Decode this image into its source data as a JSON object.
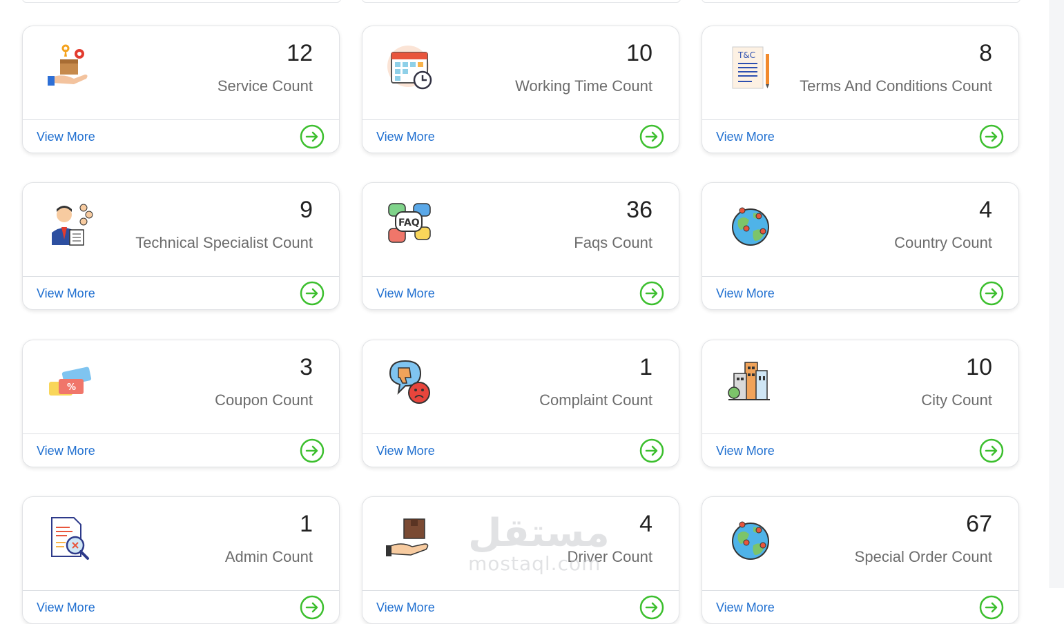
{
  "cards": [
    {
      "count": "12",
      "label": "Service Count",
      "link": "View More",
      "icon": "service-box-icon"
    },
    {
      "count": "10",
      "label": "Working Time Count",
      "link": "View More",
      "icon": "calendar-clock-icon"
    },
    {
      "count": "8",
      "label": "Terms And Conditions Count",
      "link": "View More",
      "icon": "terms-document-icon"
    },
    {
      "count": "9",
      "label": "Technical Specialist Count",
      "link": "View More",
      "icon": "specialist-person-icon"
    },
    {
      "count": "36",
      "label": "Faqs Count",
      "link": "View More",
      "icon": "faq-bubbles-icon"
    },
    {
      "count": "4",
      "label": "Country Count",
      "link": "View More",
      "icon": "globe-pins-icon"
    },
    {
      "count": "3",
      "label": "Coupon Count",
      "link": "View More",
      "icon": "coupon-tickets-icon"
    },
    {
      "count": "1",
      "label": "Complaint Count",
      "link": "View More",
      "icon": "complaint-thumbs-down-icon"
    },
    {
      "count": "10",
      "label": "City Count",
      "link": "View More",
      "icon": "city-buildings-icon"
    },
    {
      "count": "1",
      "label": "Admin Count",
      "link": "View More",
      "icon": "document-search-icon"
    },
    {
      "count": "4",
      "label": "Driver Count",
      "link": "View More",
      "icon": "hand-package-icon"
    },
    {
      "count": "67",
      "label": "Special Order Count",
      "link": "View More",
      "icon": "globe-pins-icon"
    }
  ],
  "watermark": {
    "arabic": "مستقل",
    "latin": "mostaql.com"
  },
  "colors": {
    "link": "#1f6fd0",
    "arrow": "#3cbf2e",
    "count": "#222222",
    "label": "#6c6c6c"
  }
}
